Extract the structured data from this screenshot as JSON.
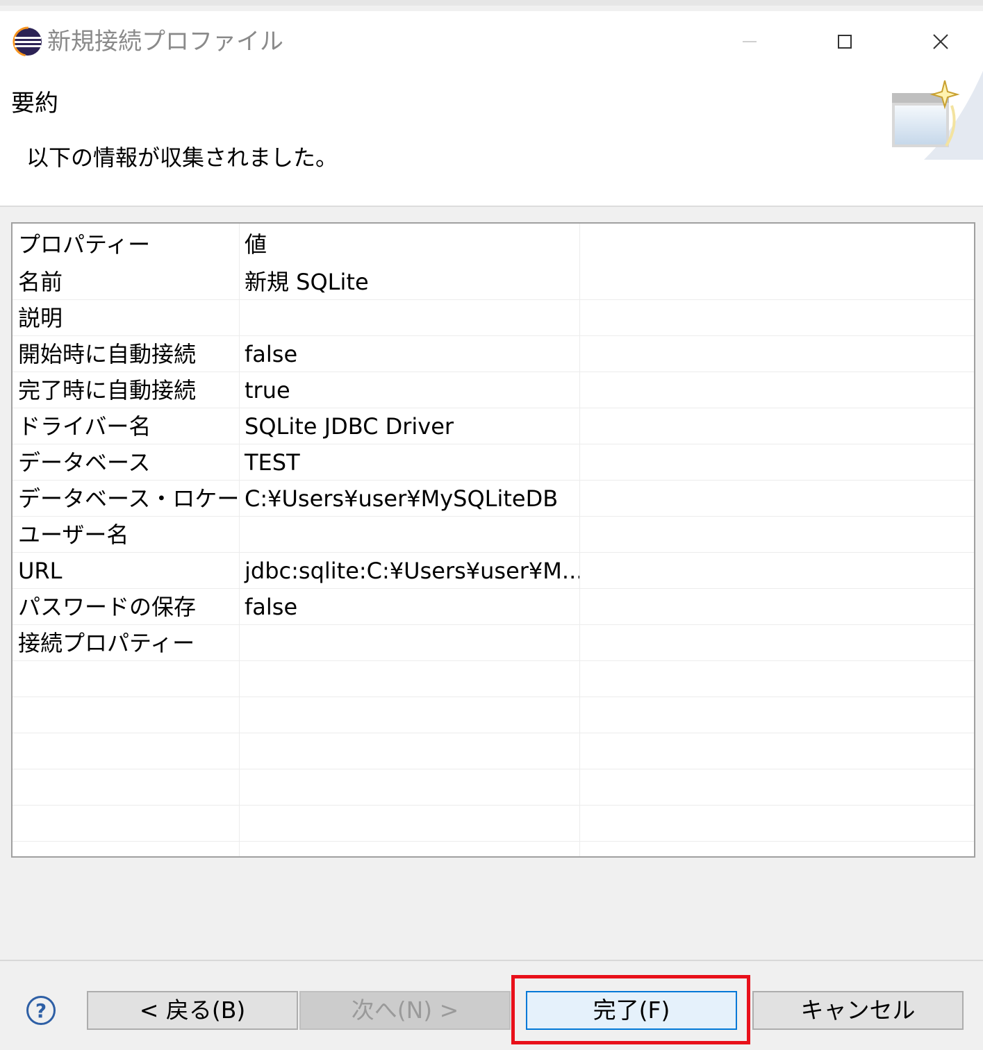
{
  "window": {
    "title": "新規接続プロファイル"
  },
  "header": {
    "title": "要約",
    "description": "以下の情報が収集されました。"
  },
  "table": {
    "columns": [
      "プロパティー",
      "値",
      ""
    ],
    "rows": [
      {
        "property": "名前",
        "value": "新規 SQLite"
      },
      {
        "property": "説明",
        "value": ""
      },
      {
        "property": "開始時に自動接続",
        "value": "false"
      },
      {
        "property": "完了時に自動接続",
        "value": "true"
      },
      {
        "property": "ドライバー名",
        "value": "SQLite JDBC Driver"
      },
      {
        "property": "データベース",
        "value": "TEST"
      },
      {
        "property": "データベース・ロケーシ...",
        "value": "C:¥Users¥user¥MySQLiteDB"
      },
      {
        "property": "ユーザー名",
        "value": ""
      },
      {
        "property": "URL",
        "value": "jdbc:sqlite:C:¥Users¥user¥M..."
      },
      {
        "property": "パスワードの保存",
        "value": "false"
      },
      {
        "property": "接続プロパティー",
        "value": ""
      }
    ]
  },
  "buttons": {
    "help": "?",
    "back": "< 戻る(B)",
    "next": "次へ(N) >",
    "finish": "完了(F)",
    "cancel": "キャンセル"
  },
  "colors": {
    "highlight": "#e8101a",
    "focus": "#0078d7"
  }
}
